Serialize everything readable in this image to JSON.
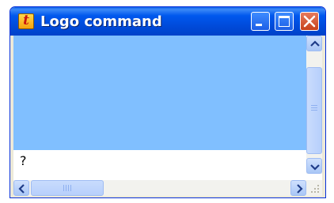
{
  "window": {
    "title": "Logo command",
    "app_icon": {
      "name": "logo-t-icon",
      "glyph": "t"
    },
    "controls": [
      "minimize",
      "maximize",
      "close"
    ]
  },
  "console": {
    "output_text": "",
    "output_background": "#80bfff",
    "prompt_text": "?"
  },
  "scrollbars": {
    "vertical": [
      "up",
      "down"
    ],
    "horizontal": [
      "left",
      "right"
    ]
  },
  "colors": {
    "titlebar": "#0058ee",
    "close_button": "#c7421c",
    "output_area": "#80bfff"
  }
}
